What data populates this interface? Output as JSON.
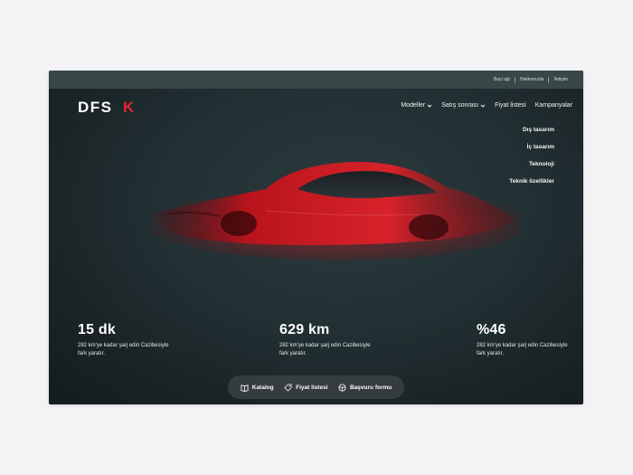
{
  "topbar": {
    "links": [
      "Bayi ağı",
      "Hakkımızda",
      "İletişim"
    ]
  },
  "brand": {
    "logo_text": "DFSK",
    "accent": "#e3262c"
  },
  "nav": {
    "items": [
      {
        "label": "Modeller",
        "has_dropdown": true
      },
      {
        "label": "Satış sonrası",
        "has_dropdown": true
      },
      {
        "label": "Fiyat listesi",
        "has_dropdown": false
      },
      {
        "label": "Kampanyalar",
        "has_dropdown": false
      }
    ]
  },
  "submenu": {
    "items": [
      "Dış tasarım",
      "İç tasarım",
      "Teknoloji",
      "Teknik özellikler"
    ]
  },
  "stats": [
    {
      "value": "15 dk",
      "desc": "282 km'ye kadar şarj edin Cazibesiyle fark yaratır."
    },
    {
      "value": "629 km",
      "desc": "282 km'ye kadar şarj edin Cazibesiyle fark yaratır."
    },
    {
      "value": "%46",
      "desc": "282 km'ye kadar şarj edin Cazibesiyle fark yaratır."
    }
  ],
  "actions": {
    "catalog": "Katalog",
    "price_list": "Fiyat listesi",
    "apply_form": "Başvuru formu"
  },
  "colors": {
    "background": "#1e292c",
    "car": "#c5161d"
  }
}
